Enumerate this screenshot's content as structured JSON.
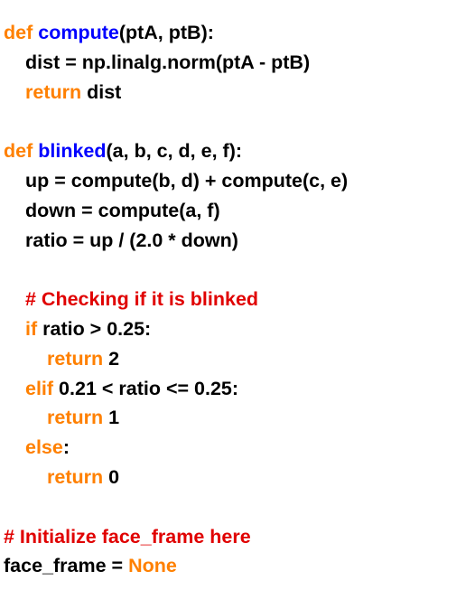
{
  "code": {
    "l1": {
      "kw": "def",
      "fn": "compute",
      "rest": "(ptA, ptB):"
    },
    "l2": {
      "text": "dist = np.linalg.norm(ptA - ptB)"
    },
    "l3": {
      "kw": "return",
      "rest": " dist"
    },
    "l5": {
      "kw": "def",
      "fn": "blinked",
      "rest": "(a, b, c, d, e, f):"
    },
    "l6": {
      "text": "up = compute(b, d) + compute(c, e)"
    },
    "l7": {
      "text": "down = compute(a, f)"
    },
    "l8": {
      "text": "ratio = up / (2.0 * down)"
    },
    "l10": {
      "comment": "# Checking if it is blinked"
    },
    "l11": {
      "kw": "if",
      "rest": " ratio > 0.25:"
    },
    "l12": {
      "kw": "return",
      "rest": " 2"
    },
    "l13": {
      "kw": "elif",
      "rest": " 0.21 < ratio <= 0.25:"
    },
    "l14": {
      "kw": "return",
      "rest": " 1"
    },
    "l15": {
      "kw": "else",
      "rest": ":"
    },
    "l16": {
      "kw": "return",
      "rest": " 0"
    },
    "l18": {
      "comment": "# Initialize face_frame here"
    },
    "l19": {
      "text": "face_frame = ",
      "kw": "None"
    }
  },
  "colors": {
    "keyword": "#ff8000",
    "function_name": "#0000ff",
    "comment": "#e00000",
    "text": "#000000",
    "background": "#ffffff"
  }
}
